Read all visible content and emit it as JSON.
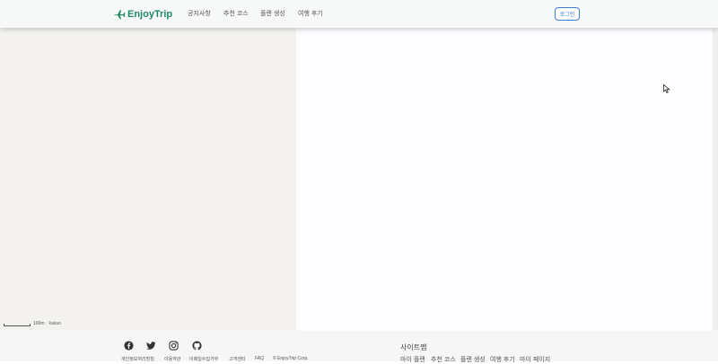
{
  "header": {
    "logo_text": "EnjoyTrip",
    "nav": [
      {
        "label": "공지사항"
      },
      {
        "label": "추천 코스"
      },
      {
        "label": "플랜 생성"
      },
      {
        "label": "여행 후기"
      }
    ],
    "login_label": "로그인"
  },
  "map": {
    "scale_text": "100m",
    "provider": "kakao"
  },
  "footer": {
    "social_icons": [
      "facebook-icon",
      "twitter-icon",
      "instagram-icon",
      "github-icon"
    ],
    "links": [
      {
        "label": "개인정보처리방침"
      },
      {
        "label": "이용약관"
      },
      {
        "label": "이메일수집거부"
      },
      {
        "label": "고객센터"
      },
      {
        "label": "FAQ"
      }
    ],
    "copyright": "© EnjoyTrip Corp.",
    "sitemap_title": "사이트맵",
    "sitemap_links": [
      {
        "label": "마이 플랜"
      },
      {
        "label": "추천 코스"
      },
      {
        "label": "플랜 생성"
      },
      {
        "label": "여행 후기"
      },
      {
        "label": "마이 페이지"
      }
    ]
  },
  "colors": {
    "brand": "#1e8a5e",
    "login_border": "#3a7bd5"
  }
}
